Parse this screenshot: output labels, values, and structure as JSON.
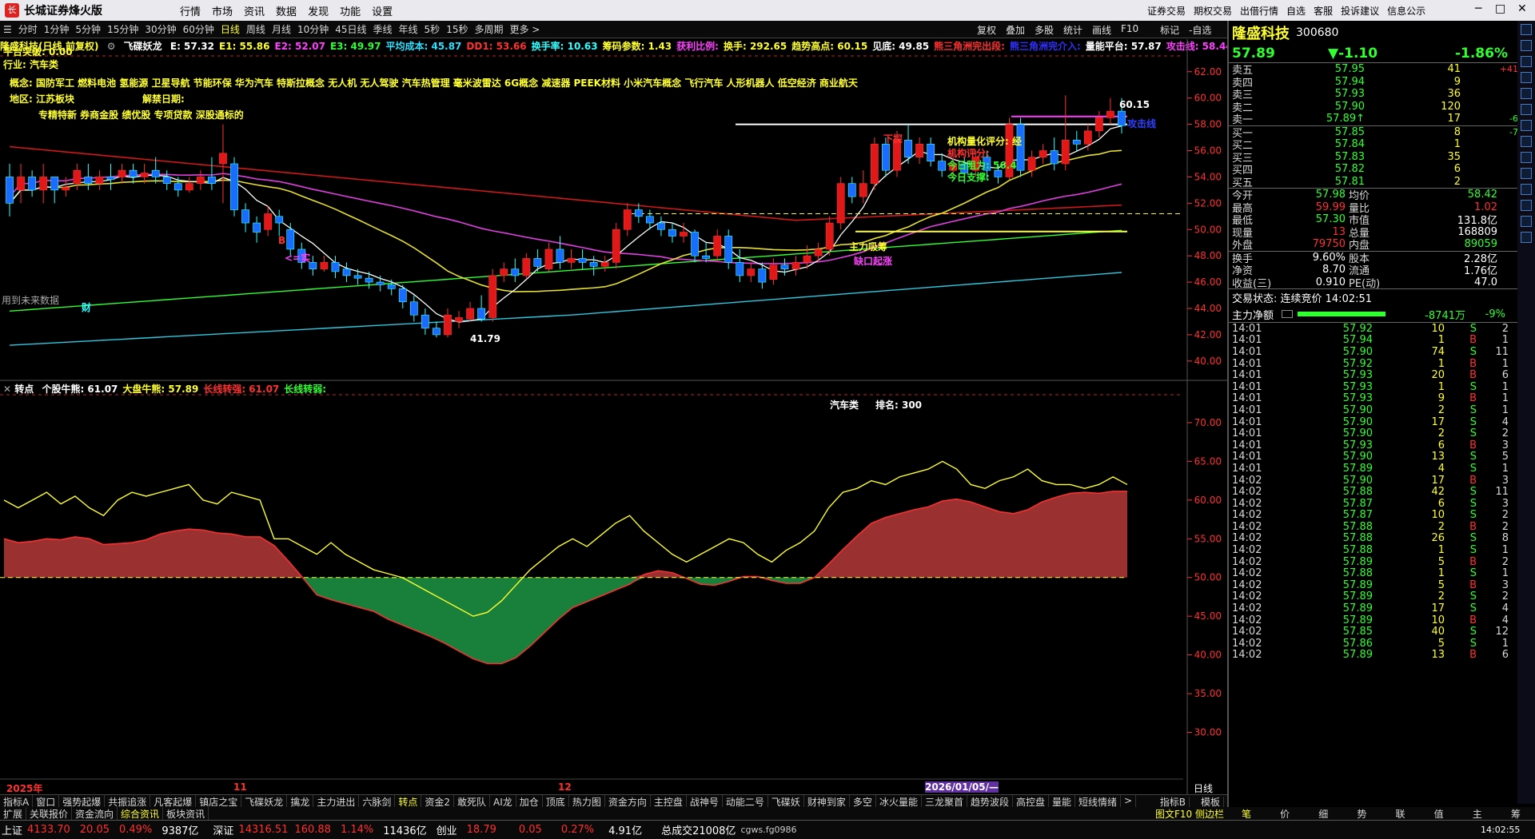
{
  "window": {
    "app_name": "长城证券烽火版",
    "menu": [
      "行情",
      "市场",
      "资讯",
      "数据",
      "发现",
      "功能",
      "设置"
    ],
    "right_menu": [
      "证券交易",
      "期权交易",
      "出借行情",
      "自选",
      "客服",
      "投诉建议",
      "信息公示"
    ]
  },
  "periods": [
    "分时",
    "1分钟",
    "5分钟",
    "15分钟",
    "30分钟",
    "60分钟",
    "日线",
    "周线",
    "月线",
    "10分钟",
    "45日线",
    "季线",
    "年线",
    "5秒",
    "15秒",
    "多周期",
    "更多 >"
  ],
  "active_period": "日线",
  "toolbar_right": [
    "复权",
    "叠加",
    "多股",
    "统计",
    "画线",
    "F10",
    "标记",
    "-自选",
    "返回"
  ],
  "info": {
    "stock": "隆盛科技(日线,前复权)",
    "indicator": "飞碟妖龙",
    "items": [
      {
        "t": "E: 57.32",
        "c": "#ffffff"
      },
      {
        "t": "E1: 55.86",
        "c": "#ffff30"
      },
      {
        "t": "E2: 52.07",
        "c": "#ff40ff"
      },
      {
        "t": "E3: 49.97",
        "c": "#30ff30"
      },
      {
        "t": "平均成本: 45.87",
        "c": "#30e0ff"
      },
      {
        "t": "DD1: 53.66",
        "c": "#ff3030"
      },
      {
        "t": "换手率: 10.63",
        "c": "#30ffff"
      },
      {
        "t": "筹码参数: 1.43",
        "c": "#ffff30"
      },
      {
        "t": "获利比例:",
        "c": "#ff40ff"
      },
      {
        "t": "换手: 292.65",
        "c": "#ffff30"
      },
      {
        "t": "趋势高点: 60.15",
        "c": "#ffff30"
      },
      {
        "t": "见底: 49.85",
        "c": "#ffffff"
      },
      {
        "t": "熊三角洲完出段:",
        "c": "#ff3030"
      },
      {
        "t": "熊三角洲完介入:",
        "c": "#3030ff"
      },
      {
        "t": "量能平台: 57.87",
        "c": "#ffffff"
      },
      {
        "t": "攻击线: 58.44",
        "c": "#ff40ff"
      }
    ]
  },
  "overlays": {
    "platform": "平台突破: 0.00",
    "industry": "行业: 汽车类",
    "concepts": "概念: 国防军工 燃料电池 氢能源 卫星导航 节能环保 华为汽车 特斯拉概念 无人机 无人驾驶 汽车热管理 毫米波雷达 6G概念 减速器 PEEK材料 小米汽车概念 飞行汽车 人形机器人 低空经济 商业航天",
    "region": "地区: 江苏板块",
    "unlock": "解禁日期:",
    "flags": "专精特新 券商金股 绩优股 专项贷款 深股通标的",
    "future": "用到未来数据",
    "cai": "财",
    "institutional": "机构量化评分: 经",
    "rating": "机构评分:",
    "today_resist": "今日阻力: 56.4",
    "today_support": "今日支撑:",
    "dragon": "下探",
    "main_absorb": "主力吸筹",
    "pressure": "攻击线",
    "high_label": "60.15",
    "low_label": "41.79",
    "ke": "<=实",
    "gap": "缺口起涨",
    "b": "B"
  },
  "price_axis": [
    "62.00",
    "60.00",
    "58.00",
    "56.00",
    "54.00",
    "52.00",
    "50.00",
    "48.00",
    "46.00",
    "44.00",
    "42.00",
    "40.00"
  ],
  "sub": {
    "header_label": "转点",
    "header": [
      {
        "t": "个股牛熊: 61.07",
        "c": "#ffffff"
      },
      {
        "t": "大盘牛熊: 57.89",
        "c": "#ffff30"
      },
      {
        "t": "长线转强: 61.07",
        "c": "#ff3030"
      },
      {
        "t": "长线转弱:",
        "c": "#30ff30"
      }
    ],
    "sector": "汽车类",
    "rank": "排名: 300",
    "axis": [
      "70.00",
      "65.00",
      "60.00",
      "55.00",
      "50.00",
      "45.00",
      "40.00",
      "35.00",
      "30.00"
    ]
  },
  "date_axis": {
    "d1": "2025年",
    "d2": "11",
    "d3": "12",
    "d4": "2026/01/05/—",
    "period": "日线"
  },
  "tabs1": [
    "指标A",
    "窗口",
    "强势起爆",
    "共振追涨",
    "凡客起爆",
    "镇店之宝",
    "飞碟妖龙",
    "擒龙",
    "主力进出",
    "六脉剑",
    "转点",
    "资金2",
    "敢死队",
    "AI龙",
    "加仓",
    "顶底",
    "热力图",
    "资金方向",
    "主控盘",
    "战神号",
    "动能二号",
    "飞碟妖",
    "财神到家",
    "多空",
    "冰火量能",
    "三龙聚首",
    "趋势波段",
    "高控盘",
    "量能",
    "短线情绪",
    ">"
  ],
  "tabs1_right": [
    "指标B",
    "模板"
  ],
  "tabs2": [
    "扩展",
    "关联报价",
    "资金流向",
    "综合资讯",
    "板块资讯"
  ],
  "tabs2_right": "图文F10 侧边栏",
  "quote": {
    "name": "隆盛科技",
    "code": "300680",
    "price": "57.89",
    "change": "▼-1.10",
    "pct": "-1.86%",
    "sells": [
      [
        "卖五",
        "57.95",
        "41",
        "+41"
      ],
      [
        "卖四",
        "57.94",
        "9",
        ""
      ],
      [
        "卖三",
        "57.93",
        "36",
        ""
      ],
      [
        "卖二",
        "57.90",
        "120",
        ""
      ],
      [
        "卖一",
        "57.89↑",
        "17",
        "-6"
      ]
    ],
    "buys": [
      [
        "买一",
        "57.85",
        "8",
        "-7"
      ],
      [
        "买二",
        "57.84",
        "1",
        ""
      ],
      [
        "买三",
        "57.83",
        "35",
        ""
      ],
      [
        "买四",
        "57.82",
        "6",
        ""
      ],
      [
        "买五",
        "57.81",
        "2",
        ""
      ]
    ],
    "stats": [
      [
        "今开",
        "57.98",
        "均价",
        "58.42"
      ],
      [
        "最高",
        "59.99",
        "量比",
        "1.02"
      ],
      [
        "最低",
        "57.30",
        "市值",
        "131.8亿"
      ],
      [
        "现量",
        "13",
        "总量",
        "168809"
      ],
      [
        "外盘",
        "79750",
        "内盘",
        "89059"
      ]
    ],
    "stats2": [
      [
        "换手",
        "9.60%",
        "股本",
        "2.28亿"
      ],
      [
        "净资",
        "8.70",
        "流通",
        "1.76亿"
      ],
      [
        "收益(三)",
        "0.910",
        "PE(动)",
        "47.0"
      ]
    ],
    "status": "交易状态: 连续竞价 14:02:51",
    "flow_label": "主力净额",
    "flow_value": "-8741万",
    "flow_pct": "-9%"
  },
  "ticks": [
    [
      "14:01",
      "57.92",
      "10",
      "S",
      "2"
    ],
    [
      "14:01",
      "57.94",
      "1",
      "B",
      "1"
    ],
    [
      "14:01",
      "57.90",
      "74",
      "S",
      "11"
    ],
    [
      "14:01",
      "57.92",
      "1",
      "B",
      "1"
    ],
    [
      "14:01",
      "57.93",
      "20",
      "B",
      "6"
    ],
    [
      "14:01",
      "57.93",
      "1",
      "S",
      "1"
    ],
    [
      "14:01",
      "57.93",
      "9",
      "B",
      "1"
    ],
    [
      "14:01",
      "57.90",
      "2",
      "S",
      "1"
    ],
    [
      "14:01",
      "57.90",
      "17",
      "S",
      "4"
    ],
    [
      "14:01",
      "57.90",
      "2",
      "S",
      "2"
    ],
    [
      "14:01",
      "57.93",
      "6",
      "B",
      "3"
    ],
    [
      "14:01",
      "57.90",
      "13",
      "S",
      "5"
    ],
    [
      "14:01",
      "57.89",
      "4",
      "S",
      "1"
    ],
    [
      "14:02",
      "57.90",
      "17",
      "B",
      "3"
    ],
    [
      "14:02",
      "57.88",
      "42",
      "S",
      "11"
    ],
    [
      "14:02",
      "57.87",
      "6",
      "S",
      "3"
    ],
    [
      "14:02",
      "57.87",
      "10",
      "S",
      "2"
    ],
    [
      "14:02",
      "57.88",
      "2",
      "B",
      "2"
    ],
    [
      "14:02",
      "57.88",
      "26",
      "S",
      "8"
    ],
    [
      "14:02",
      "57.88",
      "1",
      "S",
      "1"
    ],
    [
      "14:02",
      "57.89",
      "5",
      "B",
      "2"
    ],
    [
      "14:02",
      "57.88",
      "1",
      "S",
      "1"
    ],
    [
      "14:02",
      "57.89",
      "5",
      "B",
      "3"
    ],
    [
      "14:02",
      "57.89",
      "2",
      "S",
      "2"
    ],
    [
      "14:02",
      "57.89",
      "17",
      "S",
      "4"
    ],
    [
      "14:02",
      "57.89",
      "10",
      "B",
      "4"
    ],
    [
      "14:02",
      "57.85",
      "40",
      "S",
      "12"
    ],
    [
      "14:02",
      "57.86",
      "5",
      "S",
      "1"
    ],
    [
      "14:02",
      "57.89",
      "13",
      "B",
      "6"
    ]
  ],
  "right_tabs": [
    "笔",
    "价",
    "细",
    "势",
    "联",
    "值",
    "主",
    "筹"
  ],
  "sidebar_chars": [
    "分",
    "时",
    "周",
    "月",
    "5",
    "15",
    "30",
    "60",
    "日",
    "周",
    "月",
    "多",
    "季",
    "年"
  ],
  "bottom": {
    "sh_label": "上证",
    "sh": "4133.70",
    "sh_chg": "20.05",
    "sh_pct": "0.49%",
    "sh_amt": "9387亿",
    "sz_label": "深证",
    "sz": "14316.51",
    "sz_chg": "160.88",
    "sz_pct": "1.14%",
    "sz_amt": "11436亿",
    "cy_label": "创业",
    "cy": "18.79",
    "cy_chg": "0.05",
    "cy_pct": "0.27%",
    "cy_amt": "4.91亿",
    "total": "总成交21008亿",
    "server": "cgws.fg0986",
    "time": "14:02:55"
  },
  "colors": {
    "up": "#ff3030",
    "down": "#30ffff",
    "bg": "#000000",
    "yellow": "#ffff30",
    "green": "#30ff30"
  },
  "chart_data": {
    "type": "candlestick",
    "xlabel": "",
    "ylabel": "",
    "ylim": [
      40,
      62
    ],
    "candles": [
      [
        54,
        52,
        55,
        51
      ],
      [
        53,
        54,
        55,
        52
      ],
      [
        54,
        53,
        54.5,
        52.5
      ],
      [
        53,
        54,
        55,
        52
      ],
      [
        54,
        53,
        54,
        52
      ],
      [
        53,
        53.2,
        54,
        52.5
      ],
      [
        53.5,
        54.5,
        55,
        53
      ],
      [
        54,
        53.5,
        55,
        53
      ],
      [
        53.5,
        54,
        54.5,
        53
      ],
      [
        54,
        53.8,
        55,
        53
      ],
      [
        54,
        54.5,
        55,
        53.5
      ],
      [
        54.5,
        54,
        55,
        53.5
      ],
      [
        54,
        54.3,
        55,
        53.5
      ],
      [
        54.5,
        54,
        55.5,
        53.5
      ],
      [
        54,
        53.5,
        54.5,
        53
      ],
      [
        53.5,
        53,
        54,
        52.5
      ],
      [
        53,
        53.5,
        54,
        52.8
      ],
      [
        53.5,
        54,
        54.5,
        53
      ],
      [
        54,
        53.5,
        55.5,
        53
      ],
      [
        55,
        55.8,
        58,
        52
      ],
      [
        55,
        51.5,
        55.5,
        51
      ],
      [
        51.5,
        50.5,
        52,
        49.8
      ],
      [
        50.5,
        49.8,
        51,
        49
      ],
      [
        50,
        51.2,
        51.8,
        49.5
      ],
      [
        51,
        50.5,
        51.5,
        49.5
      ],
      [
        50,
        48.5,
        50.5,
        48
      ],
      [
        48.5,
        47.5,
        49,
        47
      ],
      [
        47.5,
        47,
        48,
        46.5
      ],
      [
        47,
        47.5,
        48,
        46.8
      ],
      [
        47.5,
        46.8,
        48,
        46.3
      ],
      [
        47,
        46.5,
        47.5,
        46
      ],
      [
        46.5,
        46.3,
        47,
        45.8
      ],
      [
        46.3,
        46,
        46.8,
        45.5
      ],
      [
        46,
        45.8,
        46.5,
        45.3
      ],
      [
        45.8,
        45.5,
        46.2,
        45
      ],
      [
        45.5,
        44.5,
        45.8,
        44
      ],
      [
        44.5,
        43.5,
        45,
        43
      ],
      [
        43.5,
        42.5,
        44,
        42
      ],
      [
        42.5,
        42,
        43,
        41.8
      ],
      [
        42,
        43.5,
        44,
        41.8
      ],
      [
        43,
        43.3,
        43.8,
        42.5
      ],
      [
        43.2,
        44,
        44.5,
        43
      ],
      [
        44,
        43.2,
        45,
        43
      ],
      [
        43.3,
        46.5,
        47,
        43
      ],
      [
        46.5,
        47,
        47.5,
        46
      ],
      [
        47,
        46.5,
        47.8,
        46
      ],
      [
        46.5,
        47.8,
        48.2,
        46.3
      ],
      [
        47.8,
        47.2,
        48.5,
        46.8
      ],
      [
        47,
        48.5,
        49,
        46.8
      ],
      [
        48.5,
        47.5,
        49.5,
        47
      ],
      [
        47.5,
        47.8,
        48.5,
        47
      ],
      [
        47.8,
        47.5,
        48.5,
        47
      ],
      [
        47.5,
        47.2,
        48,
        46.5
      ],
      [
        47.2,
        47.5,
        48,
        46.8
      ],
      [
        47.5,
        50,
        50.5,
        47
      ],
      [
        50,
        51.5,
        52,
        49.5
      ],
      [
        51.5,
        51,
        52,
        50.5
      ],
      [
        51,
        50.5,
        51.5,
        50
      ],
      [
        50.5,
        50,
        51,
        49.5
      ],
      [
        50,
        49.5,
        50.5,
        49
      ],
      [
        49.5,
        49.8,
        50.5,
        49
      ],
      [
        49.8,
        48,
        50,
        47.5
      ],
      [
        48,
        47.8,
        49,
        47.5
      ],
      [
        48,
        49.5,
        50,
        47.5
      ],
      [
        49.5,
        47.5,
        50,
        47
      ],
      [
        47.5,
        46.5,
        48.5,
        46
      ],
      [
        46.5,
        47,
        47.5,
        46
      ],
      [
        47,
        46,
        47.5,
        45.5
      ],
      [
        46.2,
        47.3,
        47.8,
        45.8
      ],
      [
        47.3,
        47,
        47.8,
        46.5
      ],
      [
        47,
        47.5,
        48,
        46.5
      ],
      [
        47.5,
        48,
        48.8,
        47
      ],
      [
        48,
        48.5,
        49,
        47.5
      ],
      [
        48.5,
        50.5,
        51,
        48
      ],
      [
        50.5,
        53.5,
        54,
        50
      ],
      [
        53.5,
        52.5,
        54,
        52
      ],
      [
        52.5,
        53.5,
        54.5,
        52
      ],
      [
        53.5,
        56.5,
        57,
        53
      ],
      [
        56.5,
        54.5,
        57,
        54
      ],
      [
        54.5,
        56.8,
        57.5,
        54
      ],
      [
        56.8,
        55.5,
        58,
        55
      ],
      [
        55.5,
        56.5,
        57,
        55
      ],
      [
        56.5,
        55.2,
        57,
        54.8
      ],
      [
        55.2,
        54.5,
        55.8,
        54
      ],
      [
        54.5,
        55,
        56,
        54
      ],
      [
        55,
        54.3,
        55.5,
        53.5
      ],
      [
        54.5,
        55.5,
        56,
        54
      ],
      [
        55.5,
        54.5,
        56,
        53.8
      ],
      [
        54.5,
        54,
        55,
        53.5
      ],
      [
        54,
        58,
        58.5,
        53.8
      ],
      [
        58,
        54.5,
        58.5,
        54
      ],
      [
        54.5,
        55.5,
        56,
        54
      ],
      [
        55.5,
        56,
        56.5,
        55
      ],
      [
        56,
        55,
        57,
        54.5
      ],
      [
        55,
        56.8,
        60.2,
        54.5
      ],
      [
        56.8,
        56.5,
        57.5,
        56
      ],
      [
        56.5,
        57.5,
        58,
        56
      ],
      [
        57.5,
        58.5,
        59,
        57
      ],
      [
        58.5,
        59,
        60,
        58
      ],
      [
        59,
        57.9,
        60,
        57.3
      ]
    ],
    "sub_series": {
      "name": "个股牛熊",
      "values": [
        55,
        54,
        55,
        56,
        54.5,
        55.5,
        54,
        53,
        55,
        56,
        55.5,
        56,
        56.5,
        57,
        55,
        54.5,
        56,
        55.5,
        55,
        50,
        48,
        47,
        46,
        47.5,
        46,
        45,
        44,
        43.5,
        43,
        42,
        41,
        40,
        39,
        38,
        38.5,
        40,
        42,
        44,
        45.5,
        47,
        48,
        47,
        48.5,
        50,
        51,
        52,
        50.5,
        49,
        48,
        49,
        50,
        51,
        50.5,
        49,
        48,
        49.5,
        50.5,
        52,
        55,
        57,
        57.5,
        58.5,
        58,
        59,
        59.5,
        60,
        61,
        60,
        58,
        57.5,
        58.5,
        59,
        60,
        61.5,
        61,
        61,
        60.5,
        61,
        62,
        61
      ]
    }
  }
}
